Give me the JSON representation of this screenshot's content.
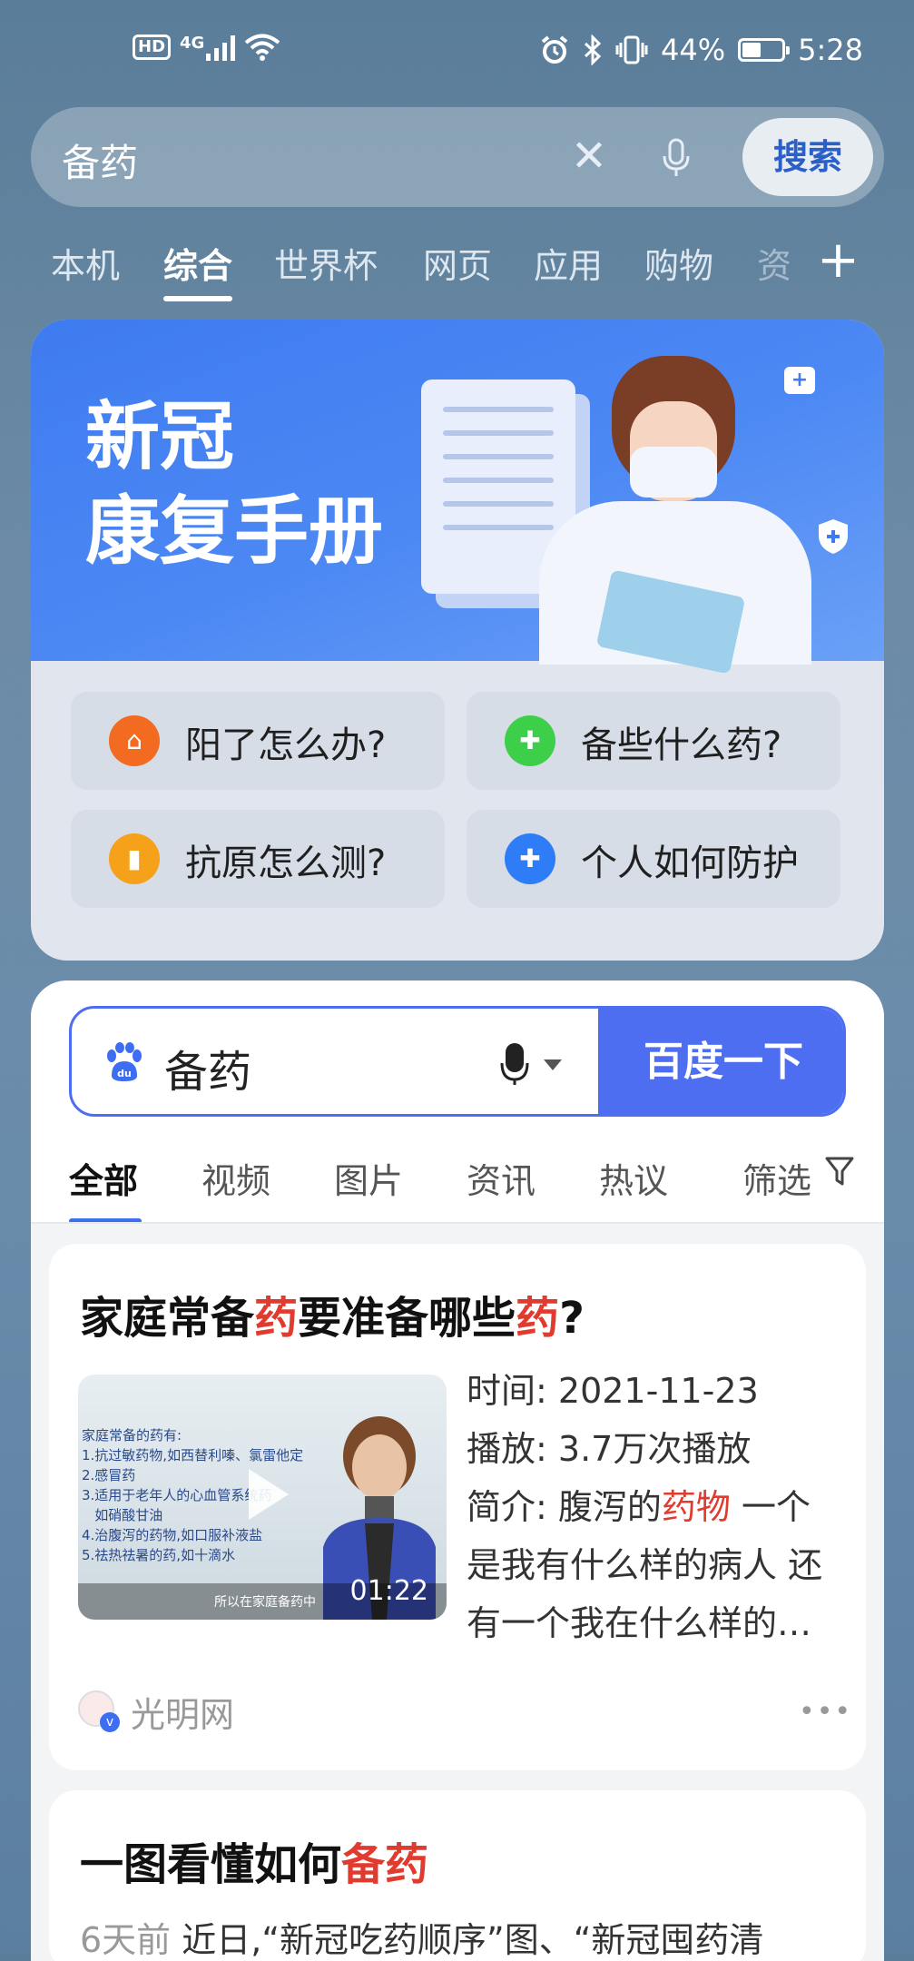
{
  "status_bar": {
    "left_icons": [
      "hd-icon",
      "4g-signal-icon",
      "wifi-icon"
    ],
    "hd": "HD",
    "net": "4G",
    "right_icons": [
      "alarm-icon",
      "bluetooth-icon",
      "vibrate-icon"
    ],
    "battery_percent": "44%",
    "time": "5:28"
  },
  "search": {
    "query": "备药",
    "search_button": "搜索"
  },
  "tabs": [
    "本机",
    "综合",
    "世界杯",
    "网页",
    "应用",
    "购物",
    "资"
  ],
  "active_tab": "综合",
  "covid_card": {
    "title_line1": "新冠",
    "title_line2": "康复手册",
    "questions": [
      {
        "label": "阳了怎么办?",
        "icon": "house-icon",
        "color": "#f36b21"
      },
      {
        "label": "备些什么药?",
        "icon": "medkit-icon",
        "color": "#3ecf4a"
      },
      {
        "label": "抗原怎么测?",
        "icon": "test-kit-icon",
        "color": "#f5a11a"
      },
      {
        "label": "个人如何防护",
        "icon": "shield-plus-icon",
        "color": "#2f7df6"
      }
    ]
  },
  "baidu": {
    "query": "备药",
    "button": "百度一下",
    "tabs": [
      "全部",
      "视频",
      "图片",
      "资讯",
      "热议",
      "筛选"
    ],
    "active_tab": "全部",
    "accent_color": "#4e6ef2"
  },
  "results": [
    {
      "title_parts": [
        "家庭常备",
        "药",
        "要准备哪些",
        "药",
        "?"
      ],
      "thumb_text": "家庭常备的药有:\n1.抗过敏药物,如西替利嗪、氯雷他定\n2.感冒药\n3.适用于老年人的心血管系统药\n   如硝酸甘油\n4.治腹泻的药物,如口服补液盐\n5.祛热祛暑的药,如十滴水",
      "thumb_caption": "所以在家庭备药中",
      "duration": "01:22",
      "time_label": "时间:",
      "time": "2021-11-23",
      "plays_label": "播放:",
      "plays": "3.7万次播放",
      "summary_label": "简介:",
      "summary_pre": "腹泻的",
      "summary_hl": "药物",
      "summary_post": " 一个",
      "summary_line2": "是我有什么样的病人 还",
      "summary_line3": "有一个我在什么样的…",
      "source": "光明网"
    },
    {
      "title_parts": [
        "一图看懂如何",
        "备药"
      ],
      "age": "6天前",
      "snippet": "近日,“新冠吃药顺序”图、“新冠囤药清"
    }
  ]
}
